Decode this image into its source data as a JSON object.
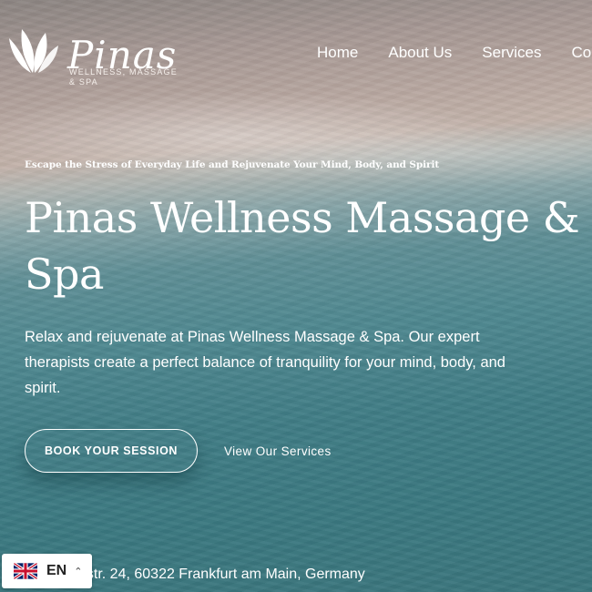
{
  "brand": {
    "name": "Pinas",
    "tagline": "WELLNESS, MASSAGE & SPA",
    "logo_icon": "lotus-leaves-icon"
  },
  "nav": {
    "items": [
      {
        "label": "Home"
      },
      {
        "label": "About Us"
      },
      {
        "label": "Services"
      },
      {
        "label": "Co"
      }
    ]
  },
  "hero": {
    "eyebrow": "Escape the Stress of Everyday Life and Rejuvenate Your Mind, Body, and Spirit",
    "title": "Pinas Wellness Massage & Spa",
    "description": "Relax and rejuvenate at Pinas Wellness Massage & Spa. Our expert therapists create a perfect balance of tranquility for your mind, body, and spirit.",
    "primary_button": "BOOK YOUR SESSION",
    "secondary_link": "View Our Services"
  },
  "address": "nstr. 24, 60322 Frankfurt am Main, Germany",
  "language_switcher": {
    "code": "EN",
    "flag_icon": "uk-flag-icon",
    "caret_icon": "chevron-up-icon"
  }
}
